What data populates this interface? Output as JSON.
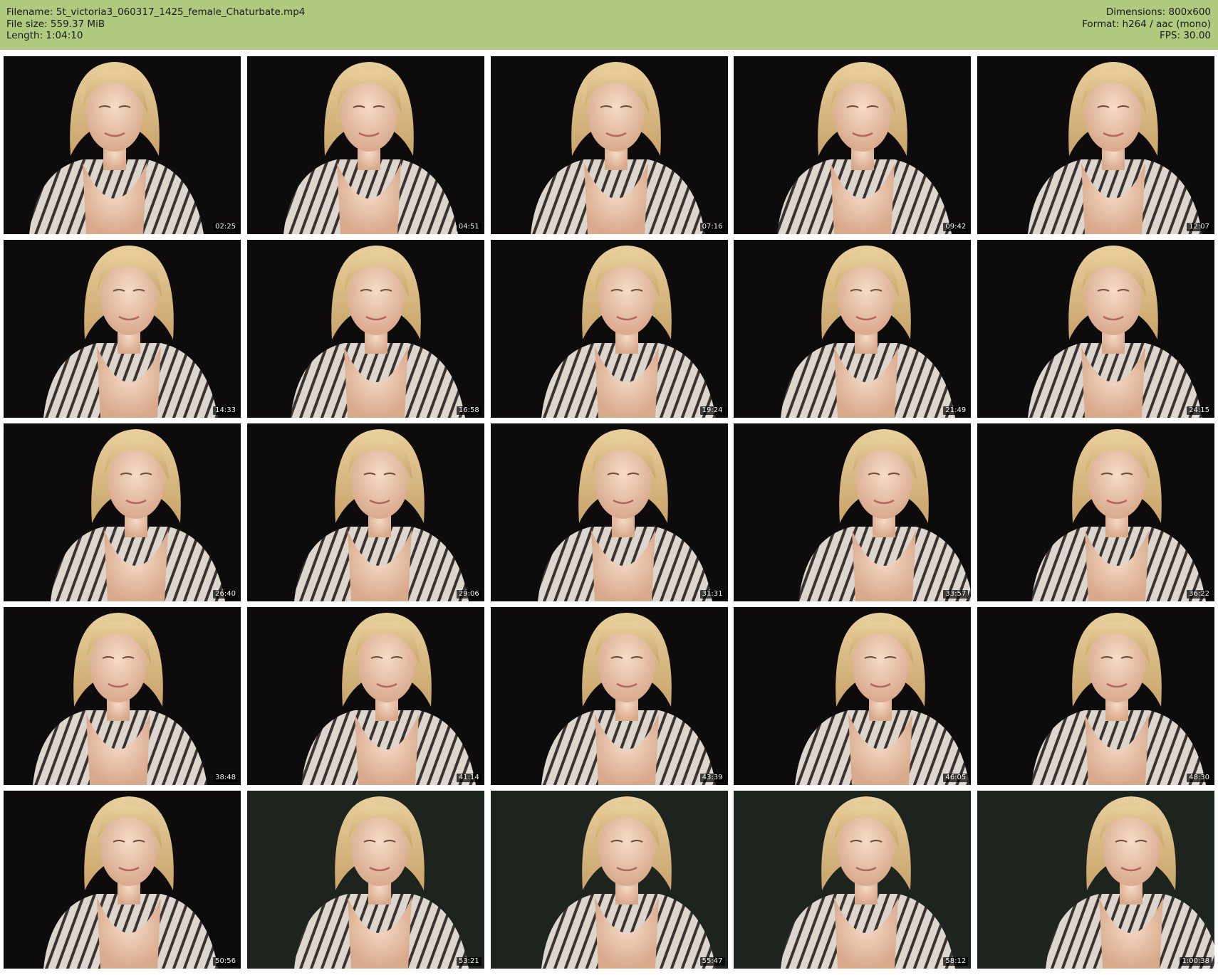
{
  "header": {
    "filename_label": "Filename:",
    "filename": "5t_victoria3_060317_1425_female_Chaturbate.mp4",
    "filesize_label": "File size:",
    "filesize": "559.37 MiB",
    "length_label": "Length:",
    "length": "1:04:10",
    "dimensions_label": "Dimensions:",
    "dimensions": "800x600",
    "format_label": "Format:",
    "format": "h264 / aac (mono)",
    "fps_label": "FPS:",
    "fps": "30.00"
  },
  "colors": {
    "header_bg": "#afc97e",
    "page_bg": "#ffffff",
    "frame_bg": "#0d0b0c"
  },
  "thumbnails": [
    {
      "timestamp": "02:25"
    },
    {
      "timestamp": "04:51"
    },
    {
      "timestamp": "07:16"
    },
    {
      "timestamp": "09:42"
    },
    {
      "timestamp": "12:07"
    },
    {
      "timestamp": "14:33"
    },
    {
      "timestamp": "16:58"
    },
    {
      "timestamp": "19:24"
    },
    {
      "timestamp": "21:49"
    },
    {
      "timestamp": "24:15"
    },
    {
      "timestamp": "26:40"
    },
    {
      "timestamp": "29:06"
    },
    {
      "timestamp": "31:31"
    },
    {
      "timestamp": "33:57"
    },
    {
      "timestamp": "36:22"
    },
    {
      "timestamp": "38:48"
    },
    {
      "timestamp": "41:14"
    },
    {
      "timestamp": "43:39"
    },
    {
      "timestamp": "46:05"
    },
    {
      "timestamp": "48:30"
    },
    {
      "timestamp": "50:56"
    },
    {
      "timestamp": "53:21"
    },
    {
      "timestamp": "55:47"
    },
    {
      "timestamp": "58:12"
    },
    {
      "timestamp": "1:00:38"
    }
  ]
}
